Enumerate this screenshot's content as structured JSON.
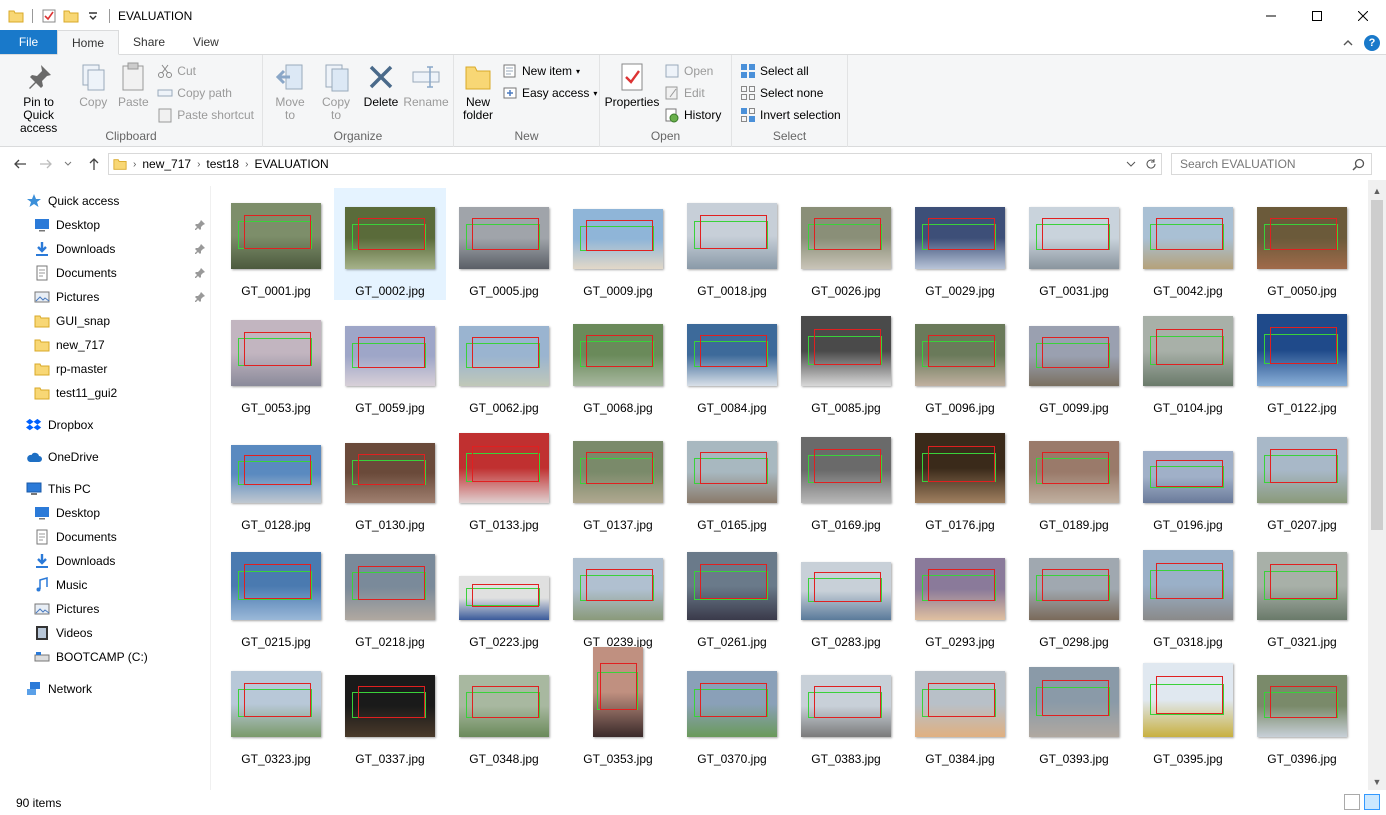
{
  "window": {
    "title": "EVALUATION"
  },
  "tabs": {
    "file": "File",
    "home": "Home",
    "share": "Share",
    "view": "View"
  },
  "ribbon": {
    "clipboard": {
      "label": "Clipboard",
      "pin": "Pin to Quick access",
      "copy": "Copy",
      "paste": "Paste",
      "cut": "Cut",
      "copy_path": "Copy path",
      "paste_shortcut": "Paste shortcut"
    },
    "organize": {
      "label": "Organize",
      "move_to": "Move to",
      "copy_to": "Copy to",
      "delete": "Delete",
      "rename": "Rename"
    },
    "new": {
      "label": "New",
      "new_folder": "New folder",
      "new_item": "New item",
      "easy_access": "Easy access"
    },
    "open": {
      "label": "Open",
      "properties": "Properties",
      "open": "Open",
      "edit": "Edit",
      "history": "History"
    },
    "select": {
      "label": "Select",
      "select_all": "Select all",
      "select_none": "Select none",
      "invert": "Invert selection"
    }
  },
  "address": {
    "crumbs": [
      "new_717",
      "test18",
      "EVALUATION"
    ],
    "search_placeholder": "Search EVALUATION"
  },
  "nav": {
    "quick_access": "Quick access",
    "quick_items": [
      "Desktop",
      "Downloads",
      "Documents",
      "Pictures",
      "GUI_snap",
      "new_717",
      "rp-master",
      "test11_gui2"
    ],
    "dropbox": "Dropbox",
    "onedrive": "OneDrive",
    "this_pc": "This PC",
    "pc_items": [
      "Desktop",
      "Documents",
      "Downloads",
      "Music",
      "Pictures",
      "Videos",
      "BOOTCAMP (C:)"
    ],
    "network": "Network"
  },
  "files": [
    "GT_0001.jpg",
    "GT_0002.jpg",
    "GT_0005.jpg",
    "GT_0009.jpg",
    "GT_0018.jpg",
    "GT_0026.jpg",
    "GT_0029.jpg",
    "GT_0031.jpg",
    "GT_0042.jpg",
    "GT_0050.jpg",
    "GT_0053.jpg",
    "GT_0059.jpg",
    "GT_0062.jpg",
    "GT_0068.jpg",
    "GT_0084.jpg",
    "GT_0085.jpg",
    "GT_0096.jpg",
    "GT_0099.jpg",
    "GT_0104.jpg",
    "GT_0122.jpg",
    "GT_0128.jpg",
    "GT_0130.jpg",
    "GT_0133.jpg",
    "GT_0137.jpg",
    "GT_0165.jpg",
    "GT_0169.jpg",
    "GT_0176.jpg",
    "GT_0189.jpg",
    "GT_0196.jpg",
    "GT_0207.jpg",
    "GT_0215.jpg",
    "GT_0218.jpg",
    "GT_0223.jpg",
    "GT_0239.jpg",
    "GT_0261.jpg",
    "GT_0283.jpg",
    "GT_0293.jpg",
    "GT_0298.jpg",
    "GT_0318.jpg",
    "GT_0321.jpg",
    "GT_0323.jpg",
    "GT_0337.jpg",
    "GT_0348.jpg",
    "GT_0353.jpg",
    "GT_0370.jpg",
    "GT_0383.jpg",
    "GT_0384.jpg",
    "GT_0393.jpg",
    "GT_0395.jpg",
    "GT_0396.jpg"
  ],
  "selected_file": "GT_0002.jpg",
  "status": {
    "count": "90 items"
  }
}
